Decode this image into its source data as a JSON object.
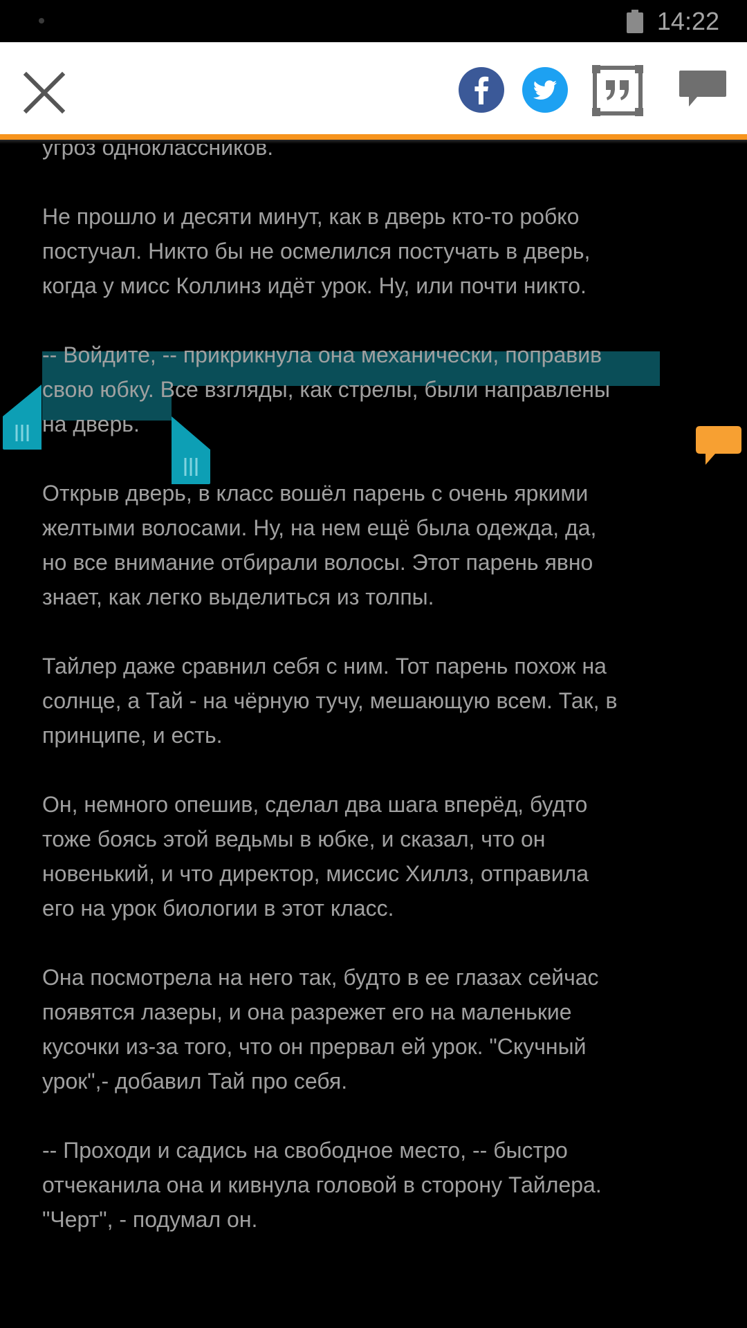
{
  "status_bar": {
    "time": "14:22",
    "icons": [
      "notification-dot-icon",
      "battery-icon"
    ]
  },
  "toolbar": {
    "icons": [
      "close-icon",
      "facebook-icon",
      "twitter-icon",
      "quote-icon",
      "comments-icon"
    ],
    "accent_color": "#f7941d"
  },
  "reader": {
    "selection_color": "#0a4e58",
    "handle_color": "#0d9fb5",
    "comment_bubble_color": "#f7a032",
    "paragraphs": [
      "угроз одноклассников.",
      "Не прошло и десяти минут, как в дверь кто-то робко\nпостучал. Никто бы не осмелился постучать в дверь,\nкогда у мисс Коллинз идёт урок. Ну, или почти никто.",
      "-- Войдите, -- прикрикнула она механически, поправив\nсвою юбку. Все взгляды, как стрелы, были направлены\nна дверь.",
      "Открыв дверь, в класс вошёл парень с очень яркими\nжелтыми волосами. Ну, на нем ещё была одежда, да,\nно все внимание отбирали волосы. Этот парень явно\nзнает, как легко выделиться из толпы.",
      "Тайлер даже сравнил себя с ним. Тот парень похож на\nсолнце, а Тай - на чёрную тучу, мешающую всем. Так, в\nпринципе, и есть.",
      "Он, немного опешив, сделал два шага вперёд, будто\nтоже боясь этой ведьмы в юбке, и сказал, что он\nновенький, и что директор, миссис Хиллз, отправила\nего на урок биологии в этот класс.",
      "Она посмотрела на него так, будто в ее глазах сейчас\nпоявятся лазеры, и она разрежет его на маленькие\nкусочки из-за того, что он прервал ей урок. \"Скучный\nурок\",- добавил Тай про себя.",
      "-- Проходи и садись на свободное место, -- быстро\nотчеканила она и кивнула головой в сторону Тайлера.\n\"Черт\", - подумал он."
    ]
  }
}
